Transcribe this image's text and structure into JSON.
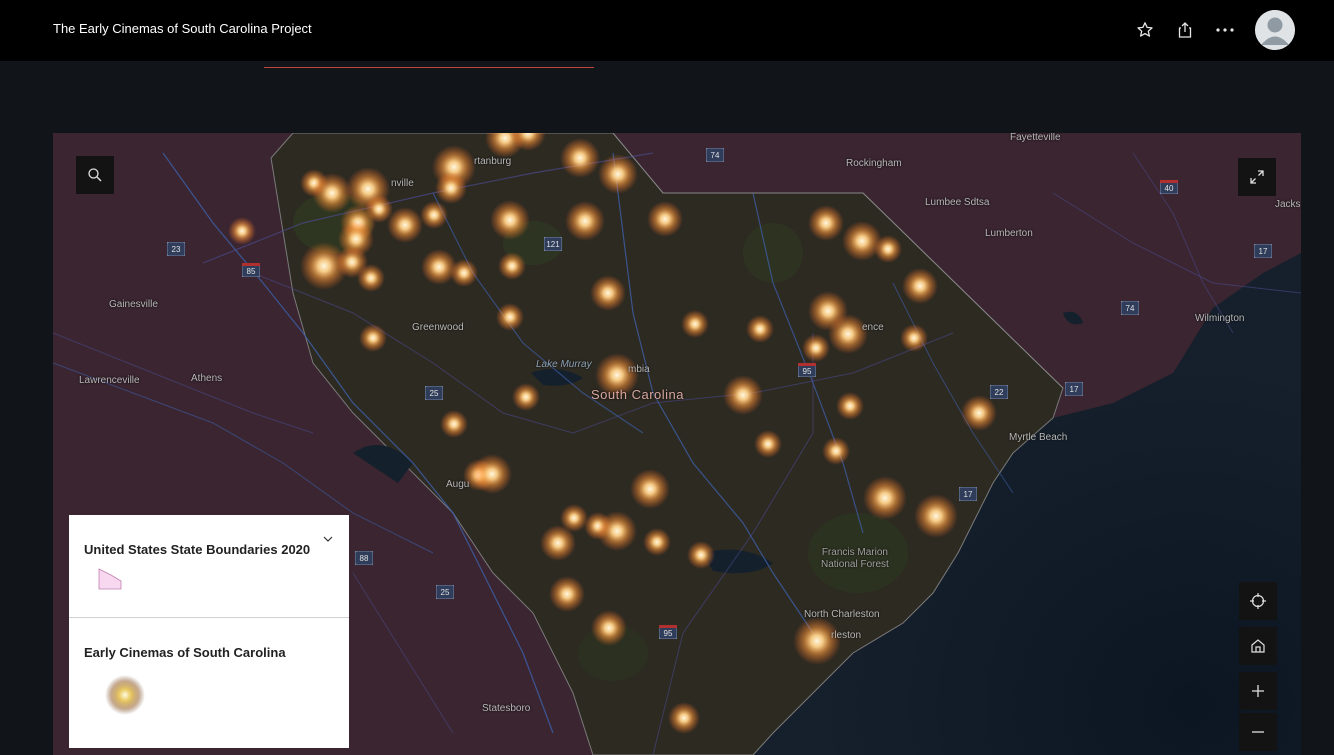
{
  "header": {
    "title": "The Early Cinemas of South Carolina Project",
    "icons": [
      "star-icon",
      "share-icon",
      "more-icon",
      "avatar"
    ]
  },
  "map": {
    "state_label": "South Carolina",
    "places": {
      "fayetteville": "Fayetteville",
      "rockingham": "Rockingham",
      "lumbee": "Lumbee Sdtsa",
      "lumberton": "Lumberton",
      "jacks": "Jacks",
      "wilmington": "Wilmington",
      "spartanburg": "rtanburg",
      "greenville": "nville",
      "gainesville": "Gainesville",
      "greenwood": "Greenwood",
      "lawrenceville": "Lawrenceville",
      "athens": "Athens",
      "columbia": "mbia",
      "florence": "ence",
      "myrtle_beach": "Myrtle Beach",
      "augusta": "Augu",
      "north_charleston": "North Charleston",
      "charleston": "rleston",
      "statesboro": "Statesboro"
    },
    "water": {
      "lake_murray": "Lake Murray"
    },
    "forest": {
      "francis_marion_1": "Francis Marion",
      "francis_marion_2": "National Forest"
    },
    "routes": [
      "74",
      "40",
      "23",
      "85",
      "121",
      "17",
      "74",
      "95",
      "22",
      "25",
      "17",
      "88",
      "25",
      "95",
      "17"
    ]
  },
  "legend": {
    "layer1_title": "United States State Boundaries 2020",
    "layer2_title": "Early Cinemas of South Carolina"
  },
  "colors": {
    "topbar": "#000000",
    "map_land": "#3a2530",
    "sc_fill": "#2c2a22",
    "glow": "#ffb060",
    "legend_swatch": "#f8d8f0"
  }
}
